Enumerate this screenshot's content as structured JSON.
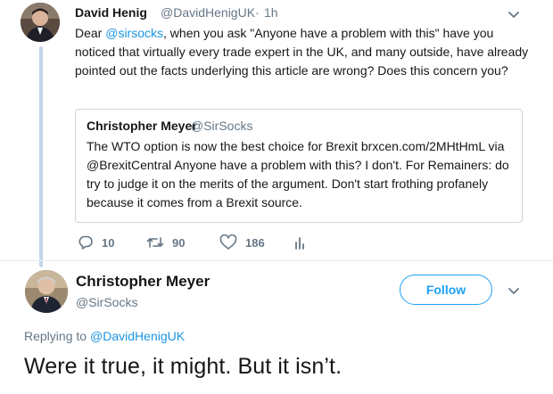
{
  "parent_tweet": {
    "author_name": "David Henig",
    "author_handle": "@DavidHenigUK",
    "separator": "·",
    "time": "1h",
    "text_prefix": "Dear ",
    "text_mention": "@sirsocks",
    "text_rest": ", when you ask \"Anyone have a problem with this\" have you noticed that virtually every trade expert in the UK, and many outside, have already pointed out the facts underlying this article are wrong? Does this concern you?",
    "quote": {
      "author_name": "Christopher Meyer",
      "author_handle": "@SirSocks",
      "text": "The WTO option is now the best choice for Brexit brxcen.com/2MHtHmL via @BrexitCentral Anyone have a problem with this? I don't. For Remainers: do try to judge it on the merits of the argument. Don't start frothing profanely because it comes from a Brexit source."
    },
    "actions": {
      "replies": "10",
      "retweets": "90",
      "likes": "186"
    }
  },
  "main_tweet": {
    "author_name": "Christopher Meyer",
    "author_handle": "@SirSocks",
    "follow_label": "Follow",
    "replying_to_label": "Replying to",
    "replying_to_handle": "@DavidHenigUK",
    "text": "Were it true, it might. But it isn’t."
  },
  "colors": {
    "accent": "#1da1f2",
    "link": "#1b95e0",
    "secondary_text": "#657786",
    "primary_text": "#14171a",
    "border": "#ccd6dd",
    "thread_line": "#c4d6ea"
  },
  "icons": [
    "chevron-down-icon",
    "reply-icon",
    "retweet-icon",
    "like-icon",
    "analytics-icon"
  ]
}
